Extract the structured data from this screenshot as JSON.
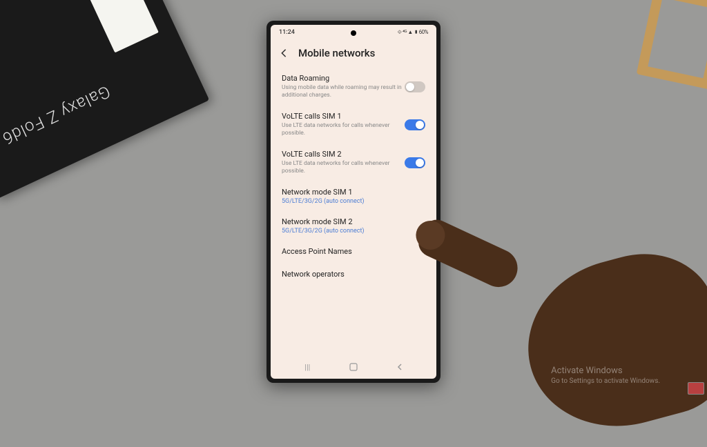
{
  "product_box": {
    "name": "Galaxy Z Fold6"
  },
  "status_bar": {
    "time": "11:24",
    "indicators": "⟐ ⁴ᴳ ▲ ▮ 60%"
  },
  "header": {
    "title": "Mobile networks"
  },
  "settings": {
    "data_roaming": {
      "title": "Data Roaming",
      "desc": "Using mobile data while roaming may result in additional charges.",
      "enabled": false
    },
    "volte1": {
      "title": "VoLTE calls SIM 1",
      "desc": "Use LTE data networks for calls whenever possible.",
      "enabled": true
    },
    "volte2": {
      "title": "VoLTE calls SIM 2",
      "desc": "Use LTE data networks for calls whenever possible.",
      "enabled": true
    },
    "netmode1": {
      "title": "Network mode SIM 1",
      "value": "5G/LTE/3G/2G (auto connect)"
    },
    "netmode2": {
      "title": "Network mode SIM 2",
      "value": "5G/LTE/3G/2G (auto connect)"
    },
    "apn": {
      "title": "Access Point Names"
    },
    "operators": {
      "title": "Network operators"
    }
  },
  "watermark": {
    "title": "Activate Windows",
    "sub": "Go to Settings to activate Windows."
  }
}
